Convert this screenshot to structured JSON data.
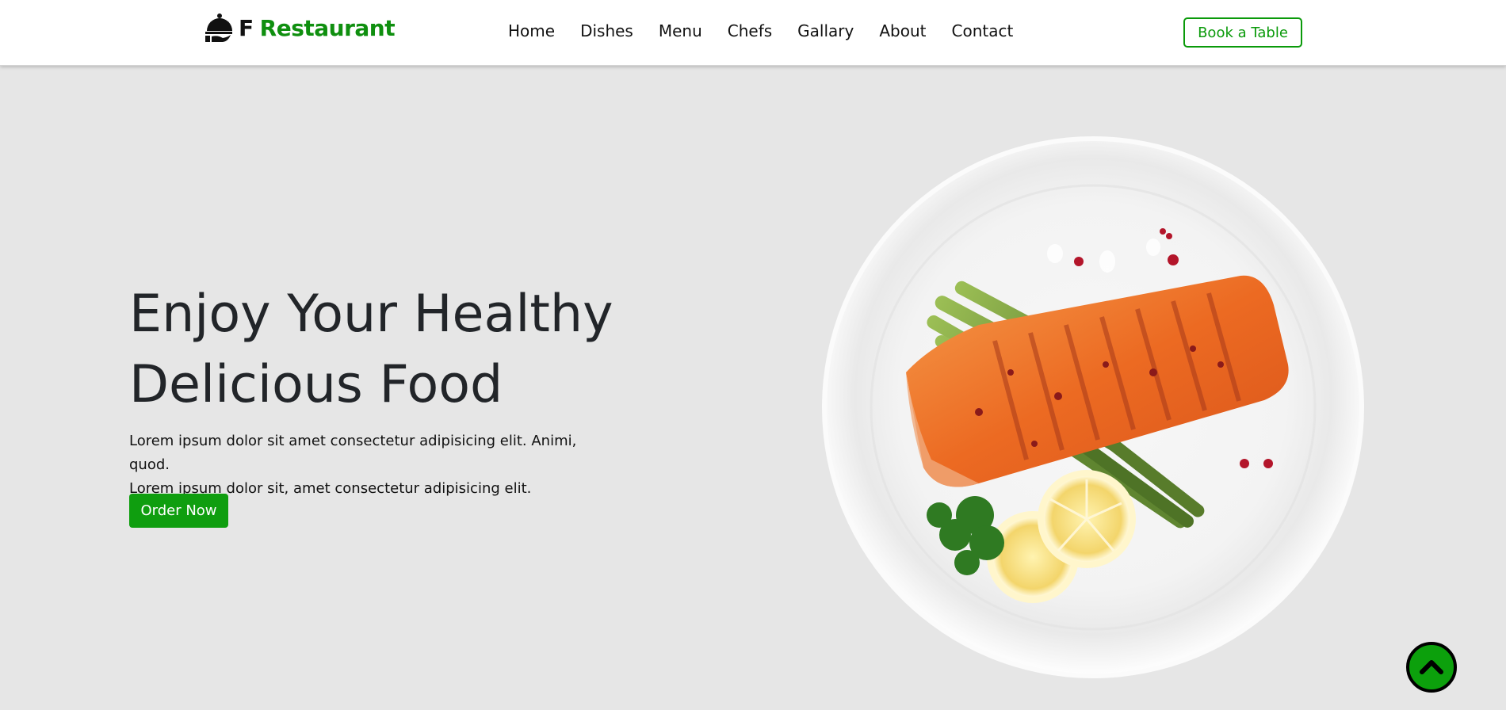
{
  "brand": {
    "icon": "cloche-icon",
    "prefix": "F",
    "name": "Restaurant"
  },
  "nav": {
    "items": [
      {
        "label": "Home"
      },
      {
        "label": "Dishes"
      },
      {
        "label": "Menu"
      },
      {
        "label": "Chefs"
      },
      {
        "label": "Gallary"
      },
      {
        "label": "About"
      },
      {
        "label": "Contact"
      }
    ],
    "book_label": "Book a Table"
  },
  "hero": {
    "title_line1": "Enjoy Your Healthy",
    "title_line2": "Delicious Food",
    "text_line1": "Lorem ipsum dolor sit amet consectetur adipisicing elit. Animi, quod.",
    "text_line2": "Lorem ipsum dolor sit, amet consectetur adipisicing elit.",
    "order_label": "Order Now",
    "image": "grilled-salmon-plate-image"
  },
  "scroll_top": {
    "icon": "chevron-up-icon"
  },
  "colors": {
    "accent": "#0f9e0f",
    "brand_green": "#0f8f0f",
    "background": "#e6e6e6",
    "heading": "#222529"
  }
}
